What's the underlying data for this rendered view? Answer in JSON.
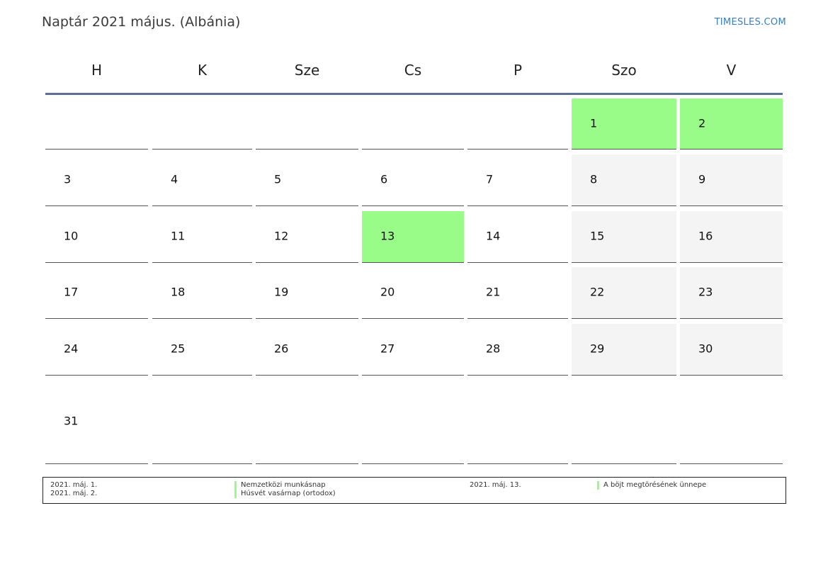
{
  "header": {
    "title": "Naptár 2021 május. (Albánia)",
    "site": "TIMESLES.COM"
  },
  "weekdays": [
    "H",
    "K",
    "Sze",
    "Cs",
    "P",
    "Szo",
    "V"
  ],
  "weeks": [
    [
      null,
      null,
      null,
      null,
      null,
      "1",
      "2"
    ],
    [
      "3",
      "4",
      "5",
      "6",
      "7",
      "8",
      "9"
    ],
    [
      "10",
      "11",
      "12",
      "13",
      "14",
      "15",
      "16"
    ],
    [
      "17",
      "18",
      "19",
      "20",
      "21",
      "22",
      "23"
    ],
    [
      "24",
      "25",
      "26",
      "27",
      "28",
      "29",
      "30"
    ],
    [
      "31",
      null,
      null,
      null,
      null,
      null,
      null
    ]
  ],
  "holiday_days": [
    "1",
    "2",
    "13"
  ],
  "colors": {
    "holiday": "#9afc88",
    "weekend": "#f4f4f4",
    "header_rule": "#5b7093",
    "link": "#3a7dbf"
  },
  "legend": {
    "col1": [
      {
        "date": "2021. máj. 1.",
        "name": "Nemzetközi munkásnap"
      },
      {
        "date": "2021. máj. 2.",
        "name": "Húsvét vasárnap (ortodox)"
      }
    ],
    "col2": [
      {
        "date": "2021. máj. 13.",
        "name": "A böjt megtörésének ünnepe"
      }
    ]
  }
}
